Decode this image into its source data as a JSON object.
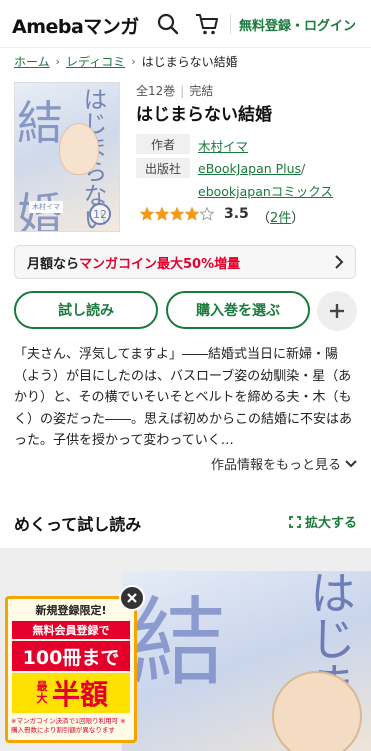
{
  "header": {
    "logo": "Amebaマンガ",
    "search_icon": "search-icon",
    "cart_icon": "cart-icon",
    "login_link": "無料登録・ログイン"
  },
  "breadcrumb": {
    "home": "ホーム",
    "category": "レディコミ",
    "current": "はじまらない結婚"
  },
  "book": {
    "volumes": "全12巻",
    "status": "完結",
    "title": "はじまらない結婚",
    "author_label": "作者",
    "author": "木村イマ",
    "publisher_label": "出版社",
    "publisher": "eBookJapan Plus",
    "publisher_sep": "/",
    "imprint": "ebookjapanコミックス",
    "rating_stars": 4,
    "rating_max": 5,
    "rating": "3.5",
    "review_open": "（",
    "review_count": "2件",
    "review_close": "）",
    "cover": {
      "char1": "結",
      "char2": "婚",
      "vertical": "はじまらない",
      "volume_mark": "12",
      "badge": "木村イマ"
    }
  },
  "promo": {
    "prefix": "月額なら",
    "highlight": "マンガコイン最大50%増量",
    "chevron_icon": "chevron-right-icon"
  },
  "actions": {
    "trial": "試し読み",
    "select_volume": "購入巻を選ぶ",
    "add_icon": "plus-icon"
  },
  "description": "「夫さん、浮気してますよ」――結婚式当日に新婦・陽（よう）が目にしたのは、バスローブ姿の幼馴染・星（あかり）と、その横でいそいそとベルトを締める夫・木（もく）の姿だった――。思えば初めからこの結婚に不安はあった。子供を授かって変わっていく…",
  "more_info": "作品情報をもっと見る",
  "trial_section": {
    "title": "めくって試し読み",
    "expand": "拡大する",
    "page_char1": "結",
    "page_char2": "はじま"
  },
  "ad": {
    "top": "新規登録限定!",
    "line1": "無料会員登録で",
    "line2": "100冊まで",
    "max": "最大",
    "half": "半額",
    "note": "※マンガコイン決済で1回限り利用可 ※購入冊数により割引額が異なります"
  },
  "colors": {
    "accent_green": "#1a7a3c",
    "promo_red": "#e4002b",
    "star_orange": "#f29a1b",
    "ad_yellow": "#ffe100"
  }
}
